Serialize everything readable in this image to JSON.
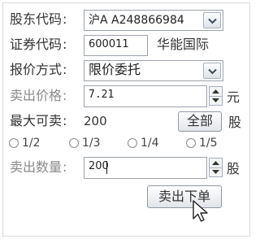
{
  "form": {
    "shareholder_code": {
      "label": "股东代码",
      "colon": ":",
      "value": "沪A A248866984"
    },
    "security_code": {
      "label": "证券代码",
      "colon": ":",
      "value": "600011",
      "security_name": "华能国际"
    },
    "quote_method": {
      "label": "报价方式",
      "colon": ":",
      "value": "限价委托"
    },
    "sell_price": {
      "label": "卖出价格",
      "colon": ":",
      "value": "7.21",
      "unit": "元"
    },
    "max_sellable": {
      "label": "最大可卖",
      "colon": ":",
      "value": "200",
      "all_button": "全部",
      "unit": "股"
    },
    "fractions": [
      "1/2",
      "1/3",
      "1/4",
      "1/5"
    ],
    "sell_quantity": {
      "label": "卖出数量",
      "colon": ":",
      "value": "200",
      "unit": "股"
    },
    "submit_label": "卖出下单"
  },
  "icons": {
    "dropdown": "chevron-down-icon",
    "spin_up": "triangle-up-icon",
    "spin_down": "triangle-down-icon",
    "cursor": "mouse-pointer-icon"
  },
  "colors": {
    "border": "#9ca3ad",
    "faded_label": "#8a8a8a",
    "text": "#333333"
  }
}
